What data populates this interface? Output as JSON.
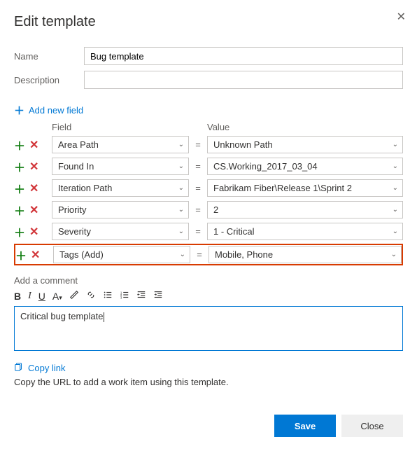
{
  "dialog": {
    "title": "Edit template",
    "close_icon": "close"
  },
  "form": {
    "name_label": "Name",
    "name_value": "Bug template",
    "description_label": "Description",
    "description_value": ""
  },
  "add_field_link": "Add new field",
  "grid": {
    "field_header": "Field",
    "value_header": "Value",
    "equals": "=",
    "rows": [
      {
        "field": "Area Path",
        "value": "Unknown Path",
        "highlighted": false
      },
      {
        "field": "Found In",
        "value": "CS.Working_2017_03_04",
        "highlighted": false
      },
      {
        "field": "Iteration Path",
        "value": "Fabrikam Fiber\\Release 1\\Sprint 2",
        "highlighted": false
      },
      {
        "field": "Priority",
        "value": "2",
        "highlighted": false
      },
      {
        "field": "Severity",
        "value": "1 - Critical",
        "highlighted": false
      },
      {
        "field": "Tags (Add)",
        "value": "Mobile, Phone",
        "highlighted": true
      }
    ]
  },
  "comment": {
    "label": "Add a comment",
    "text": "Critical bug template"
  },
  "copy_link": {
    "label": "Copy link",
    "hint": "Copy the URL to add a work item using this template."
  },
  "footer": {
    "save": "Save",
    "close": "Close"
  },
  "toolbar": {
    "bold": "B",
    "italic": "I",
    "underline": "U"
  }
}
